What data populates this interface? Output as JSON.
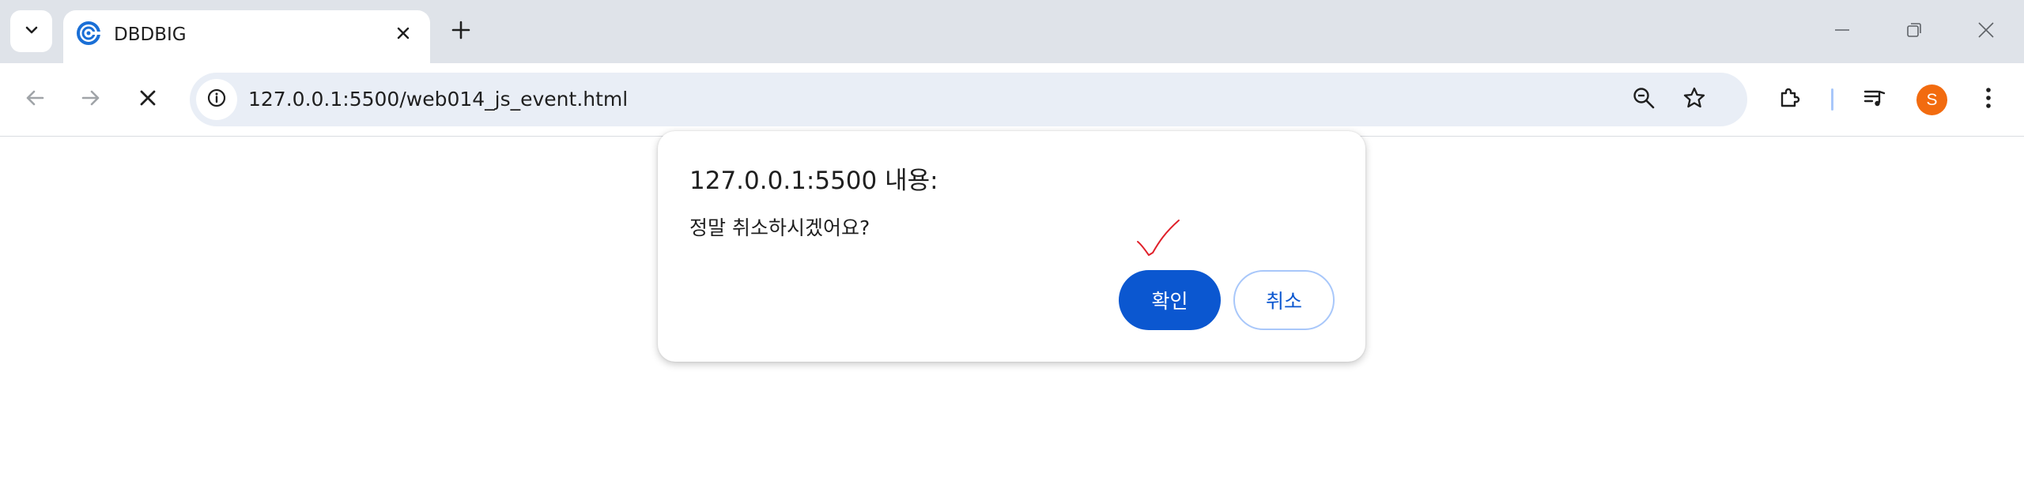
{
  "tab": {
    "title": "DBDBIG"
  },
  "address_bar": {
    "url": "127.0.0.1:5500/web014_js_event.html"
  },
  "profile": {
    "initial": "S"
  },
  "dialog": {
    "title": "127.0.0.1:5500 내용:",
    "message": "정말 취소하시겠어요?",
    "ok_label": "확인",
    "cancel_label": "취소"
  },
  "colors": {
    "tabstrip_bg": "#dfe3e9",
    "omnibox_bg": "#e9eef6",
    "primary_button": "#0b57d0",
    "avatar": "#f26b0f",
    "annotation_check": "#e0202a"
  },
  "icons": {
    "tab_search": "chevron-down-icon",
    "favicon": "site-favicon-icon",
    "tab_close": "close-icon",
    "new_tab": "plus-icon",
    "minimize": "minimize-icon",
    "restore": "restore-icon",
    "window_close": "close-icon",
    "back": "arrow-left-icon",
    "forward": "arrow-right-icon",
    "stop": "stop-loading-icon",
    "site_info": "info-icon",
    "zoom": "zoom-out-icon",
    "bookmark": "star-icon",
    "extensions": "puzzle-icon",
    "media": "media-queue-icon",
    "menu": "more-vertical-icon"
  }
}
